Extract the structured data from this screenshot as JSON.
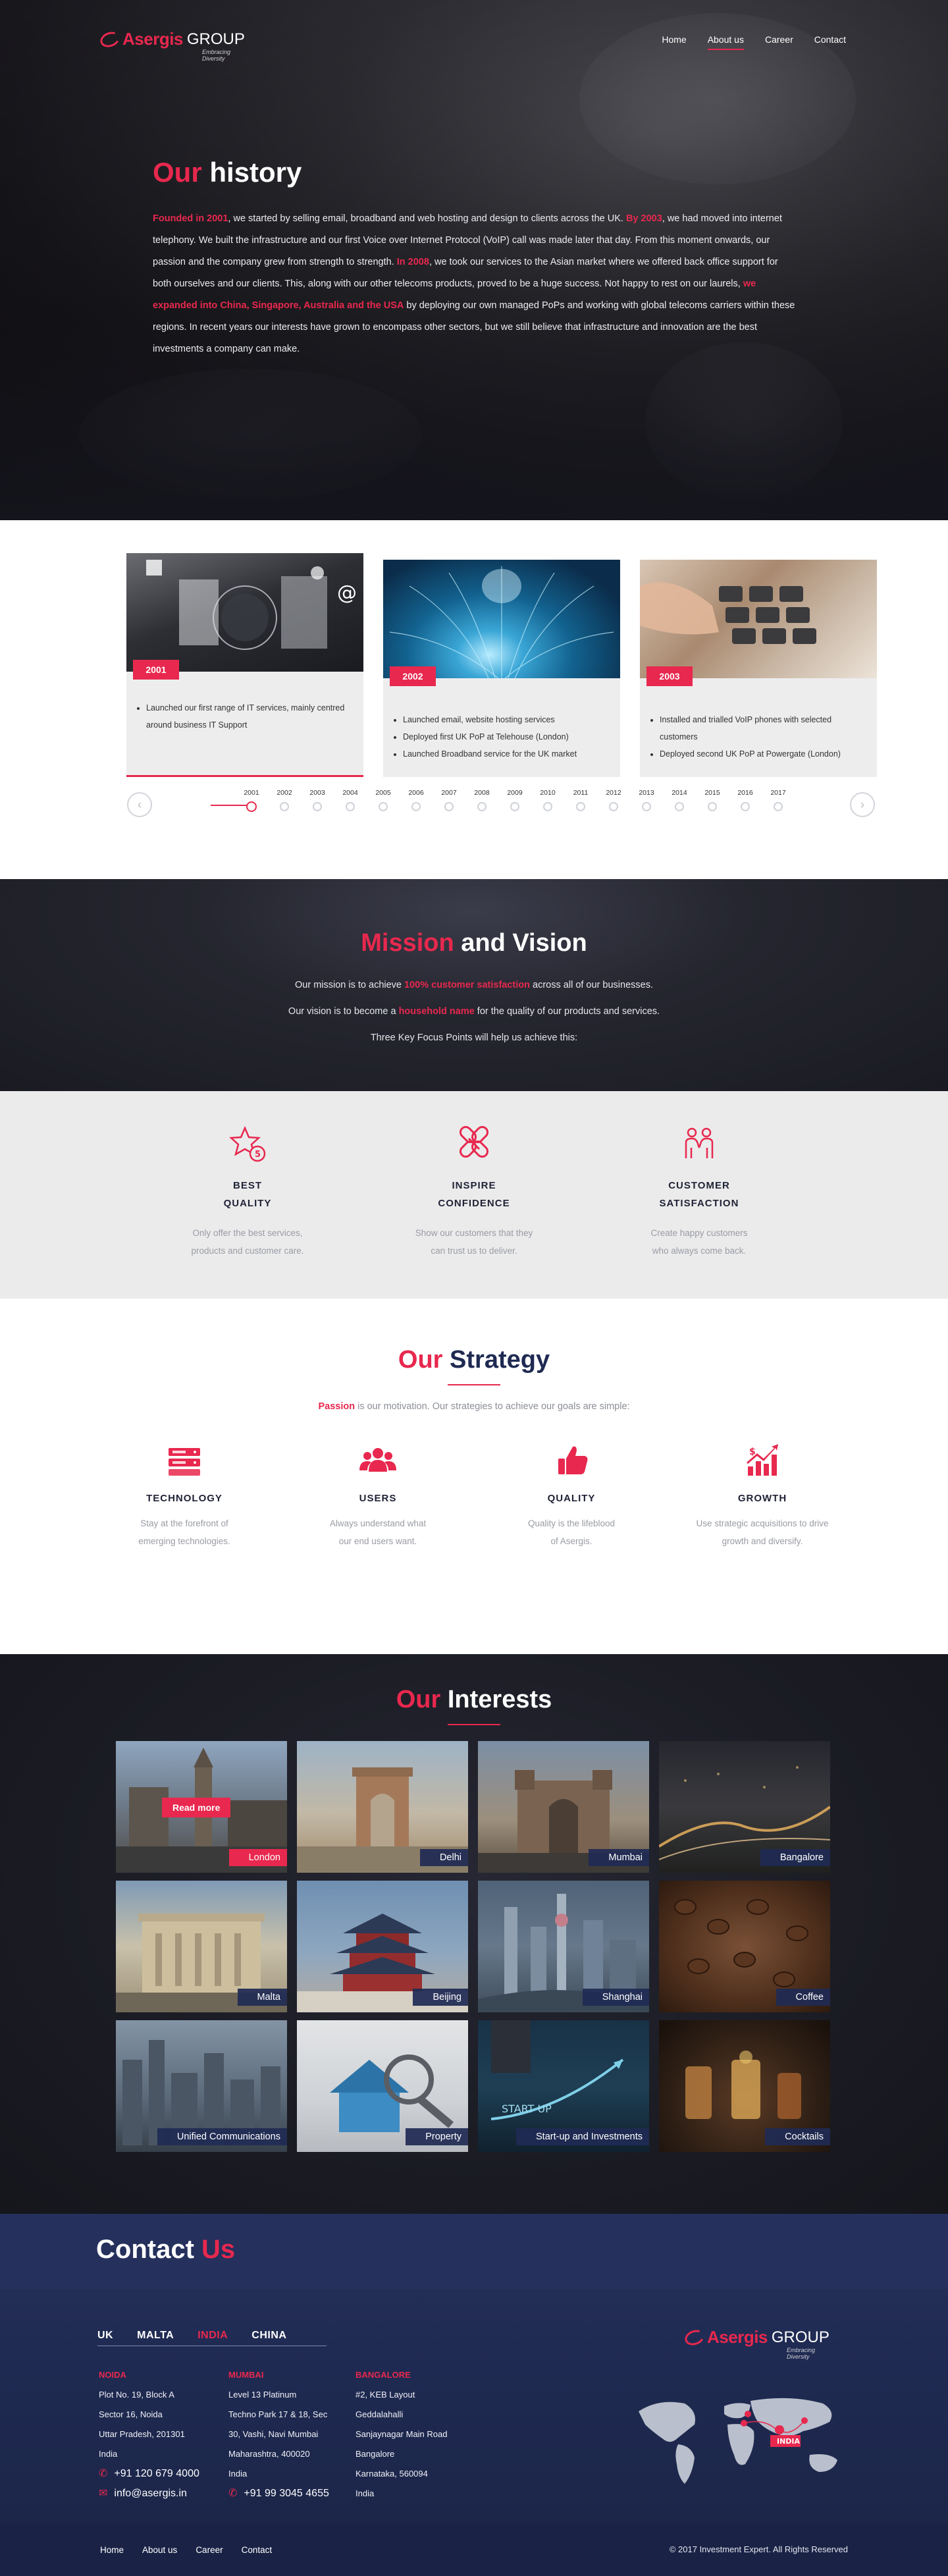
{
  "brand": {
    "name_part1": "Asergis",
    "name_part2": "GROUP",
    "tagline": "Embracing Diversity",
    "accent": "#e8284e",
    "navy": "#1f2a52"
  },
  "nav": {
    "items": [
      "Home",
      "About us",
      "Career",
      "Contact"
    ],
    "active": "About us"
  },
  "history": {
    "title_accent": "Our",
    "title_rest": "history",
    "segments": [
      {
        "text": "Founded in 2001",
        "highlight": true
      },
      {
        "text": ", we started by selling email, broadband and web hosting and design to clients across the UK. ",
        "highlight": false
      },
      {
        "text": "By 2003",
        "highlight": true
      },
      {
        "text": ", we had moved into internet telephony. We built the infrastructure and our first Voice over Internet Protocol (VoIP) call was made later that day. From this moment onwards, our passion and the company grew from strength to strength. ",
        "highlight": false
      },
      {
        "text": "In 2008",
        "highlight": true
      },
      {
        "text": ", we took our services to the Asian market where we offered back office support for both ourselves and our clients. This, along with our other telecoms products, proved to be a huge success. Not happy to rest on our laurels, ",
        "highlight": false
      },
      {
        "text": "we expanded into China, Singapore, Australia and the USA",
        "highlight": true
      },
      {
        "text": " by deploying our own managed PoPs and working with global telecoms carriers within these regions. In recent years our interests have grown to encompass other sectors, but we still believe that infrastructure and innovation are the best investments a company can make.",
        "highlight": false
      }
    ]
  },
  "timeline": {
    "cards": [
      {
        "year": "2001",
        "items": [
          "Launched our first range of IT services, mainly centred around business IT Support"
        ]
      },
      {
        "year": "2002",
        "items": [
          "Launched email, website hosting services",
          "Deployed first UK PoP at Telehouse (London)",
          "Launched Broadband service for the UK market"
        ]
      },
      {
        "year": "2003",
        "items": [
          "Installed and trialled VoIP phones with selected customers",
          "Deployed second UK PoP at Powergate (London)"
        ]
      }
    ],
    "years": [
      "2001",
      "2002",
      "2003",
      "2004",
      "2005",
      "2006",
      "2007",
      "2008",
      "2009",
      "2010",
      "2011",
      "2012",
      "2013",
      "2014",
      "2015",
      "2016",
      "2017"
    ],
    "active_year": "2001",
    "prev_icon": "chevron-left-icon",
    "next_icon": "chevron-right-icon"
  },
  "mission": {
    "title_accent": "Mission",
    "title_rest": "and Vision",
    "line1_before": "Our mission is to achieve ",
    "line1_highlight": "100% customer satisfaction",
    "line1_after": " across all of our businesses.",
    "line2_before": "Our vision is to become a ",
    "line2_highlight": "household name",
    "line2_after": " for the quality of our products and services.",
    "line3": "Three Key Focus Points will help us achieve this:"
  },
  "focus": [
    {
      "icon": "star-award-icon",
      "title_line1": "BEST",
      "title_line2": "QUALITY",
      "desc_line1": "Only offer the best services,",
      "desc_line2": "products and customer care."
    },
    {
      "icon": "link-chain-icon",
      "title_line1": "INSPIRE",
      "title_line2": "CONFIDENCE",
      "desc_line1": "Show our customers that they",
      "desc_line2": "can trust us to deliver."
    },
    {
      "icon": "people-handshake-icon",
      "title_line1": "CUSTOMER",
      "title_line2": "SATISFACTION",
      "desc_line1": "Create happy customers",
      "desc_line2": "who always come back."
    }
  ],
  "strategy": {
    "title_accent": "Our",
    "title_rest": "Strategy",
    "sub_highlight": "Passion",
    "sub_rest": " is our motivation. Our strategies to achieve our goals are simple:",
    "items": [
      {
        "icon": "server-icon",
        "title": "TECHNOLOGY",
        "desc_line1": "Stay at the forefront of",
        "desc_line2": "emerging technologies."
      },
      {
        "icon": "users-icon",
        "title": "USERS",
        "desc_line1": "Always understand what",
        "desc_line2": "our end users want."
      },
      {
        "icon": "thumbs-up-icon",
        "title": "QUALITY",
        "desc_line1": "Quality is the lifeblood",
        "desc_line2": "of Asergis."
      },
      {
        "icon": "growth-chart-icon",
        "title": "GROWTH",
        "desc_line1": "Use strategic acquisitions to drive",
        "desc_line2": "growth and diversify."
      }
    ]
  },
  "interests": {
    "title_accent": "Our",
    "title_rest": "Interests",
    "read_more": "Read more",
    "tiles": [
      "London",
      "Delhi",
      "Mumbai",
      "Bangalore",
      "Malta",
      "Beijing",
      "Shanghai",
      "Coffee",
      "Unified Communications",
      "Property",
      "Start-up and Investments",
      "Cocktails"
    ]
  },
  "contact": {
    "title_main": "Contact",
    "title_accent": "Us",
    "tabs": [
      "UK",
      "MALTA",
      "INDIA",
      "CHINA"
    ],
    "active_tab": "INDIA",
    "offices": [
      {
        "city": "NOIDA",
        "lines": [
          "Plot No. 19, Block A",
          "Sector 16, Noida",
          "Uttar Pradesh, 201301",
          "India"
        ],
        "phone": "+91 120 679 4000",
        "email": "info@asergis.in"
      },
      {
        "city": "MUMBAI",
        "lines": [
          "Level 13 Platinum",
          "Techno Park 17 & 18, Sec",
          "30, Vashi, Navi Mumbai",
          "Maharashtra, 400020",
          "India"
        ],
        "phone": "+91 99 3045 4655"
      },
      {
        "city": "BANGALORE",
        "lines": [
          "#2, KEB Layout",
          "Geddalahalli",
          "Sanjaynagar Main Road",
          "Bangalore",
          "Karnataka, 560094",
          "India"
        ]
      }
    ],
    "map_label": "INDIA",
    "phone_icon": "phone-icon",
    "email_icon": "email-icon"
  },
  "footer": {
    "links": [
      "Home",
      "About us",
      "Career",
      "Contact"
    ],
    "copyright": "© 2017 Investment Expert. All Rights Reserved"
  }
}
